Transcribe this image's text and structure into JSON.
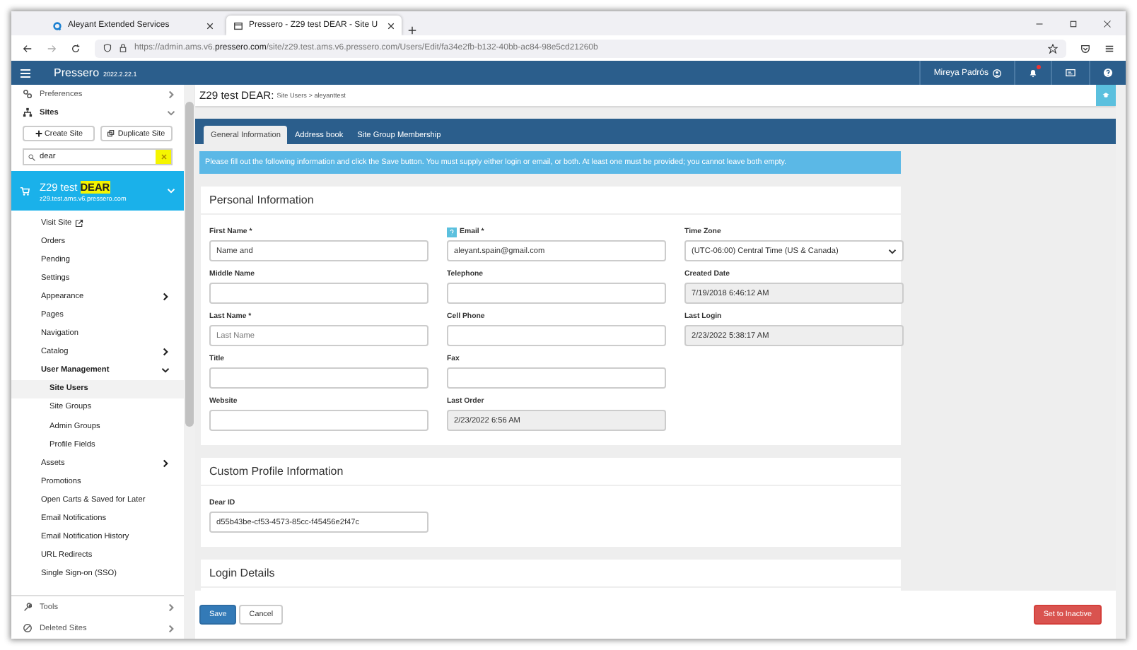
{
  "browser": {
    "tabs": [
      {
        "title": "Aleyant Extended Services",
        "selected": false
      },
      {
        "title": "Pressero - Z29 test DEAR - Site U",
        "selected": true
      }
    ],
    "url": {
      "prefix": "https://admin.ams.v6.",
      "domain": "pressero.com",
      "path": "/site/z29.test.ams.v6.pressero.com/Users/Edit/fa34e2fb-b132-40bb-ac84-98e5cd21260b"
    }
  },
  "app_bar": {
    "brand": "Pressero",
    "version": "2022.2.22.1",
    "user": "Mireya Padrós",
    "notifications_unread": true
  },
  "sidebar": {
    "preferences": {
      "label": "Preferences"
    },
    "sites": {
      "label": "Sites",
      "expanded": true
    },
    "buttons": [
      "Create Site",
      "Duplicate Site"
    ],
    "search": {
      "value": "dear"
    },
    "site_card": {
      "name": "Z29 test",
      "match": "DEAR",
      "host": "z29.test.ams.v6.pressero.com",
      "expanded": true
    },
    "menu": [
      {
        "label": "Visit Site",
        "kind": "external",
        "selected": false
      },
      {
        "label": "Orders",
        "kind": "link",
        "selected": false
      },
      {
        "label": "Pending",
        "kind": "link",
        "selected": false
      },
      {
        "label": "Settings",
        "kind": "link",
        "selected": false
      },
      {
        "label": "Appearance",
        "kind": "submenu",
        "expanded": false,
        "selected": false
      },
      {
        "label": "Pages",
        "kind": "link",
        "selected": false
      },
      {
        "label": "Navigation",
        "kind": "link",
        "selected": false
      },
      {
        "label": "Catalog",
        "kind": "submenu",
        "expanded": false,
        "selected": false
      },
      {
        "label": "User Management",
        "kind": "submenu",
        "expanded": true,
        "selected": false,
        "children": [
          {
            "label": "Site Users",
            "selected": true
          },
          {
            "label": "Site Groups",
            "selected": false
          },
          {
            "label": "Admin Groups",
            "selected": false
          },
          {
            "label": "Profile Fields",
            "selected": false
          }
        ]
      },
      {
        "label": "Assets",
        "kind": "submenu",
        "expanded": false,
        "selected": false
      },
      {
        "label": "Promotions",
        "kind": "link",
        "selected": false
      },
      {
        "label": "Open Carts & Saved for Later",
        "kind": "link",
        "selected": false
      },
      {
        "label": "Email Notifications",
        "kind": "link",
        "selected": false
      },
      {
        "label": "Email Notification History",
        "kind": "link",
        "selected": false
      },
      {
        "label": "URL Redirects",
        "kind": "link",
        "selected": false
      },
      {
        "label": "Single Sign-on (SSO)",
        "kind": "link",
        "selected": false
      }
    ],
    "bottom": [
      {
        "label": "Tools"
      },
      {
        "label": "Deleted Sites"
      }
    ]
  },
  "header": {
    "title": "Z29 test DEAR:",
    "breadcrumb": "Site Users > aleyanttest"
  },
  "tabs": [
    {
      "label": "General Information",
      "selected": true
    },
    {
      "label": "Address book",
      "selected": false
    },
    {
      "label": "Site Group Membership",
      "selected": false
    }
  ],
  "notice": "Please fill out the following information and click the Save button. You must supply either login or email, or both. At least one must be provided; you cannot leave both empty.",
  "sections": [
    {
      "title": "Personal Information",
      "columns": [
        [
          {
            "label": "First Name *",
            "kind": "text",
            "value": "Name and"
          },
          {
            "label": "Middle Name",
            "kind": "text"
          },
          {
            "label": "Last Name *",
            "kind": "text",
            "placeholder": "Last Name"
          },
          {
            "label": "Title",
            "kind": "text"
          },
          {
            "label": "Website",
            "kind": "text"
          }
        ],
        [
          {
            "label": "Email *",
            "kind": "text",
            "help": true,
            "value": "aleyant.spain@gmail.com"
          },
          {
            "label": "Telephone",
            "kind": "text"
          },
          {
            "label": "Cell Phone",
            "kind": "text"
          },
          {
            "label": "Fax",
            "kind": "text"
          },
          {
            "label": "Last Order",
            "kind": "readonly",
            "value": "2/23/2022 6:56 AM"
          }
        ],
        [
          {
            "label": "Time Zone",
            "kind": "select",
            "value": "(UTC-06:00) Central Time (US & Canada)"
          },
          {
            "label": "Created Date",
            "kind": "readonly",
            "value": "7/19/2018 6:46:12 AM"
          },
          {
            "label": "Last Login",
            "kind": "readonly",
            "value": "2/23/2022 5:38:17 AM"
          }
        ]
      ]
    },
    {
      "title": "Custom Profile Information",
      "columns": [
        [
          {
            "label": "Dear ID",
            "kind": "text",
            "value": "d55b43be-cf53-4573-85cc-f45456e2f47c"
          }
        ]
      ]
    },
    {
      "title": "Login Details"
    }
  ],
  "footer": [
    {
      "label": "Save",
      "kind": "primary"
    },
    {
      "label": "Cancel",
      "kind": "default"
    },
    {
      "label": "Set to Inactive",
      "kind": "danger"
    }
  ]
}
